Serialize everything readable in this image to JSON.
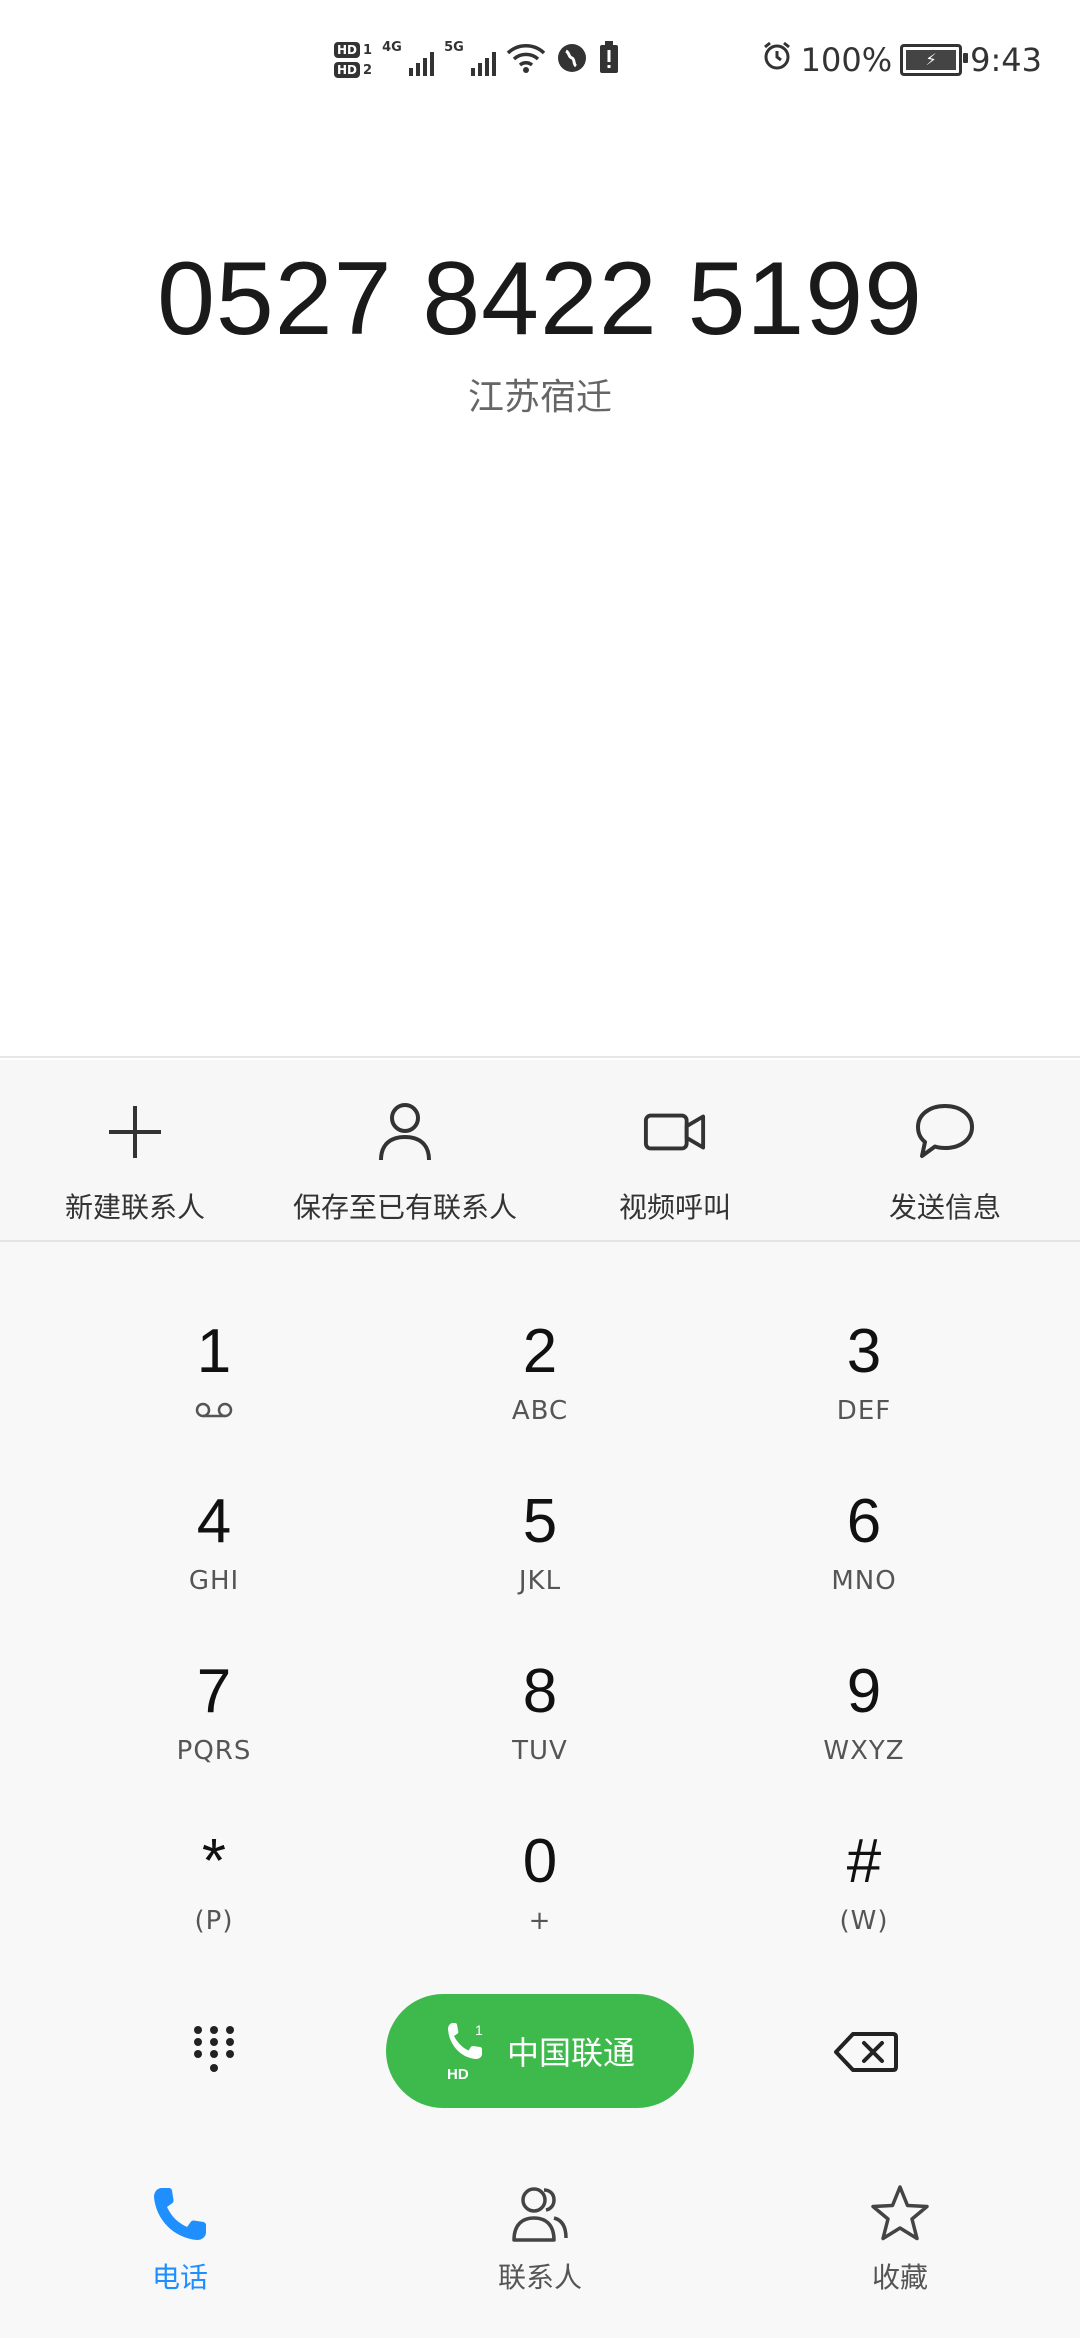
{
  "status_bar": {
    "sim1_label": "HD",
    "sim1_index": "1",
    "sim2_label": "HD",
    "sim2_index": "2",
    "network1": "4G",
    "network2": "5G",
    "battery": "100%",
    "time": "9:43"
  },
  "dialer": {
    "number": "0527 8422 5199",
    "location": "江苏宿迁"
  },
  "actions": [
    {
      "label": "新建联系人",
      "icon": "plus-icon"
    },
    {
      "label": "保存至已有联系人",
      "icon": "person-icon"
    },
    {
      "label": "视频呼叫",
      "icon": "video-camera-icon"
    },
    {
      "label": "发送信息",
      "icon": "chat-bubble-icon"
    }
  ],
  "keypad": [
    {
      "digit": "1",
      "sub": ""
    },
    {
      "digit": "2",
      "sub": "ABC"
    },
    {
      "digit": "3",
      "sub": "DEF"
    },
    {
      "digit": "4",
      "sub": "GHI"
    },
    {
      "digit": "5",
      "sub": "JKL"
    },
    {
      "digit": "6",
      "sub": "MNO"
    },
    {
      "digit": "7",
      "sub": "PQRS"
    },
    {
      "digit": "8",
      "sub": "TUV"
    },
    {
      "digit": "9",
      "sub": "WXYZ"
    },
    {
      "digit": "*",
      "sub": "(P)"
    },
    {
      "digit": "0",
      "sub": "+"
    },
    {
      "digit": "#",
      "sub": "(W)"
    }
  ],
  "call_button": {
    "carrier": "中国联通",
    "sim_index": "1",
    "hd": "HD"
  },
  "bottom_nav": [
    {
      "label": "电话",
      "icon": "phone-icon",
      "active": true
    },
    {
      "label": "联系人",
      "icon": "contacts-icon",
      "active": false
    },
    {
      "label": "收藏",
      "icon": "star-icon",
      "active": false
    }
  ],
  "colors": {
    "call_green": "#3dba4b",
    "active_blue": "#1f8fff"
  }
}
